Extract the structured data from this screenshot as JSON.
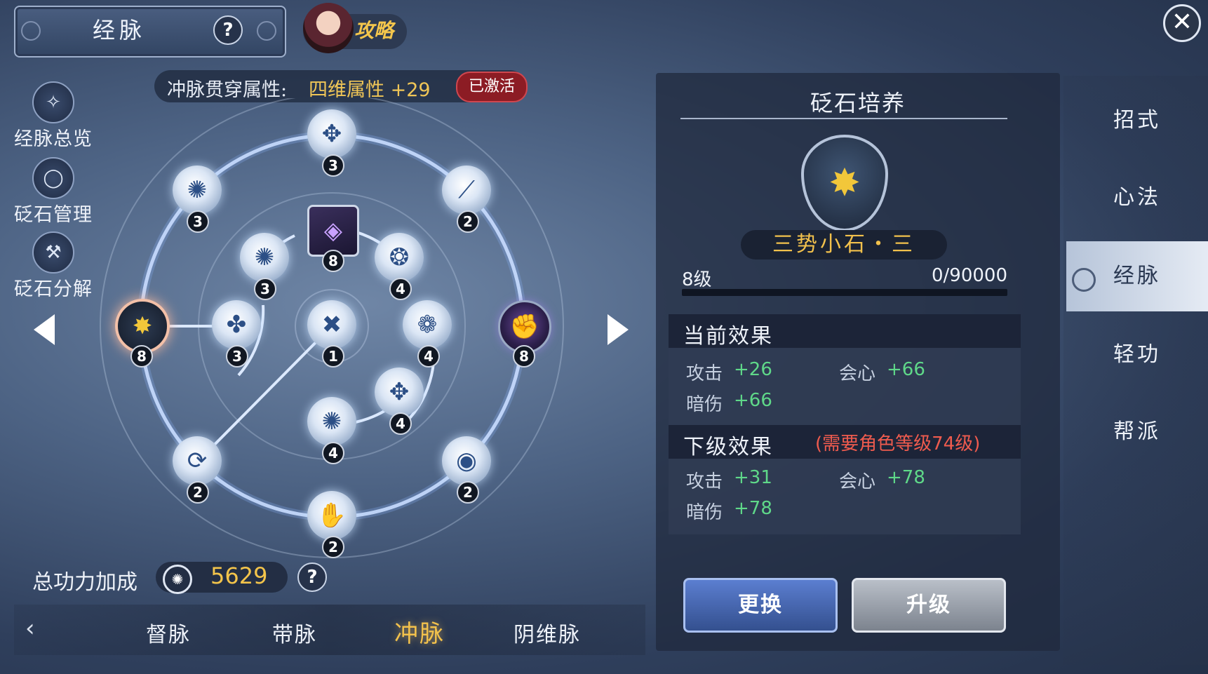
{
  "header": {
    "title": "经脉",
    "help": "?",
    "guide_label": "攻略",
    "close": "✕"
  },
  "sidebar": [
    {
      "label": "经脉总览",
      "icon": "constellation-icon"
    },
    {
      "label": "砭石管理",
      "icon": "ring-icon"
    },
    {
      "label": "砭石分解",
      "icon": "hammer-icon"
    }
  ],
  "meridian": {
    "attr_label": "冲脉贯穿属性:",
    "attr_value": "四维属性 +29",
    "attr_status": "已激活",
    "nodes": [
      {
        "level": "3",
        "glyph": "✥",
        "icon": "swirl-icon"
      },
      {
        "level": "3",
        "glyph": "✺",
        "icon": "tri-swirl-icon"
      },
      {
        "level": "2",
        "glyph": "⟋",
        "icon": "blades-icon"
      },
      {
        "level": "8",
        "glyph": "◈",
        "icon": "violet-gem-icon"
      },
      {
        "level": "3",
        "glyph": "✺",
        "icon": "tri-swirl-icon"
      },
      {
        "level": "4",
        "glyph": "❂",
        "icon": "spiral-icon"
      },
      {
        "level": "8",
        "glyph": "✸",
        "icon": "golden-sword-icon"
      },
      {
        "level": "3",
        "glyph": "✤",
        "icon": "mask-icon"
      },
      {
        "level": "1",
        "glyph": "✖",
        "icon": "cross-icon"
      },
      {
        "level": "4",
        "glyph": "❁",
        "icon": "cloud-swirl-icon"
      },
      {
        "level": "8",
        "glyph": "✊",
        "icon": "purple-fist-icon"
      },
      {
        "level": "4",
        "glyph": "✥",
        "icon": "swirl-icon"
      },
      {
        "level": "4",
        "glyph": "✺",
        "icon": "tri-swirl-icon"
      },
      {
        "level": "2",
        "glyph": "⟳",
        "icon": "scroll-icon"
      },
      {
        "level": "2",
        "glyph": "◉",
        "icon": "eye-icon"
      },
      {
        "level": "2",
        "glyph": "✋",
        "icon": "palm-icon"
      }
    ]
  },
  "power": {
    "label": "总功力加成",
    "value": "5629",
    "help": "?"
  },
  "tabs": [
    "督脉",
    "带脉",
    "冲脉",
    "阴维脉"
  ],
  "tab_back": "‹",
  "panel": {
    "title": "砭石培养",
    "stone_name": "三势小石・三",
    "level": "8级",
    "xp": "0/90000",
    "xp_fraction": 0,
    "current_title": "当前效果",
    "current": [
      {
        "name": "攻击",
        "value": "+26"
      },
      {
        "name": "会心",
        "value": "+66"
      },
      {
        "name": "暗伤",
        "value": "+66"
      }
    ],
    "next_title": "下级效果",
    "next_requirement": "(需要角色等级74级)",
    "next": [
      {
        "name": "攻击",
        "value": "+31"
      },
      {
        "name": "会心",
        "value": "+78"
      },
      {
        "name": "暗伤",
        "value": "+78"
      }
    ],
    "replace_btn": "更换",
    "upgrade_btn": "升级"
  },
  "right_nav": [
    "招式",
    "心法",
    "经脉",
    "轻功",
    "帮派"
  ],
  "colors": {
    "gold": "#f2c14c",
    "green": "#5fd889",
    "red": "#ef5b4e",
    "active_badge": "#8c1c24"
  }
}
